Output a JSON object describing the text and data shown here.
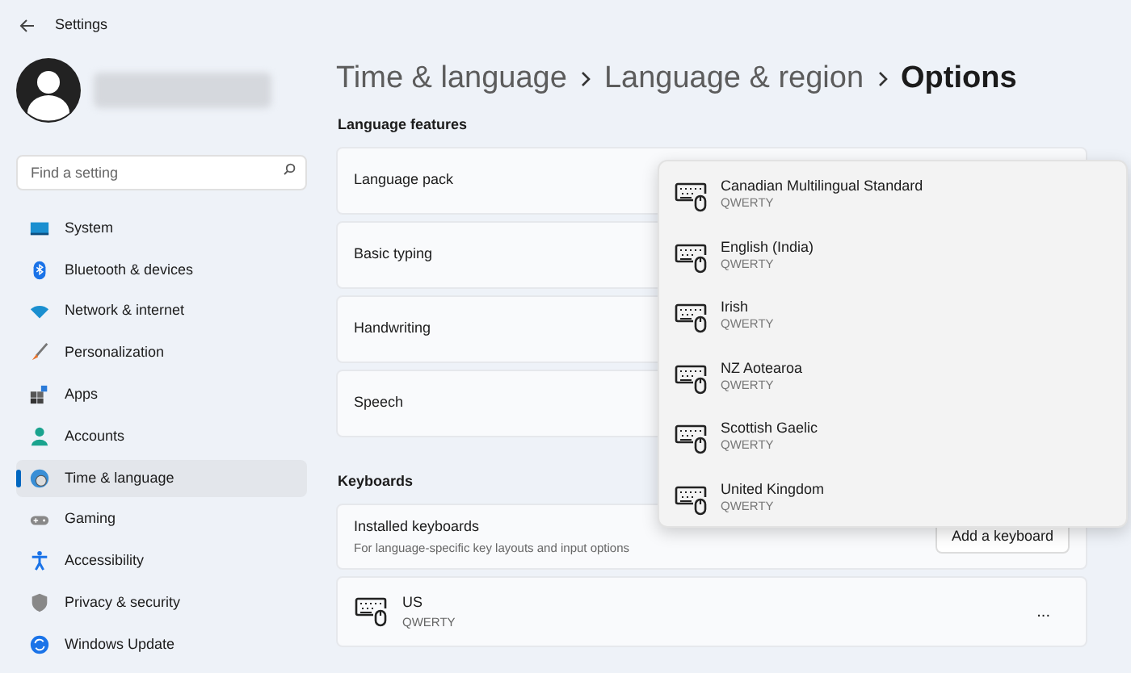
{
  "window": {
    "title": "Settings"
  },
  "search": {
    "placeholder": "Find a setting"
  },
  "nav": [
    {
      "label": "System",
      "selected": false
    },
    {
      "label": "Bluetooth & devices",
      "selected": false
    },
    {
      "label": "Network & internet",
      "selected": false
    },
    {
      "label": "Personalization",
      "selected": false
    },
    {
      "label": "Apps",
      "selected": false
    },
    {
      "label": "Accounts",
      "selected": false
    },
    {
      "label": "Time & language",
      "selected": true
    },
    {
      "label": "Gaming",
      "selected": false
    },
    {
      "label": "Accessibility",
      "selected": false
    },
    {
      "label": "Privacy & security",
      "selected": false
    },
    {
      "label": "Windows Update",
      "selected": false
    }
  ],
  "breadcrumb": [
    "Time & language",
    "Language & region",
    "Options"
  ],
  "language_features": {
    "heading": "Language features",
    "items": [
      "Language pack",
      "Basic typing",
      "Handwriting",
      "Speech"
    ]
  },
  "keyboards": {
    "heading": "Keyboards",
    "installed": {
      "title": "Installed keyboards",
      "subtitle": "For language-specific key layouts and input options",
      "button": "Add a keyboard"
    },
    "list": [
      {
        "name": "US",
        "layout": "QWERTY",
        "menu": "..."
      }
    ]
  },
  "dropdown": [
    {
      "name": "Canadian Multilingual Standard",
      "layout": "QWERTY"
    },
    {
      "name": "English (India)",
      "layout": "QWERTY"
    },
    {
      "name": "Irish",
      "layout": "QWERTY"
    },
    {
      "name": "NZ Aotearoa",
      "layout": "QWERTY"
    },
    {
      "name": "Scottish Gaelic",
      "layout": "QWERTY"
    },
    {
      "name": "United Kingdom",
      "layout": "QWERTY"
    }
  ]
}
